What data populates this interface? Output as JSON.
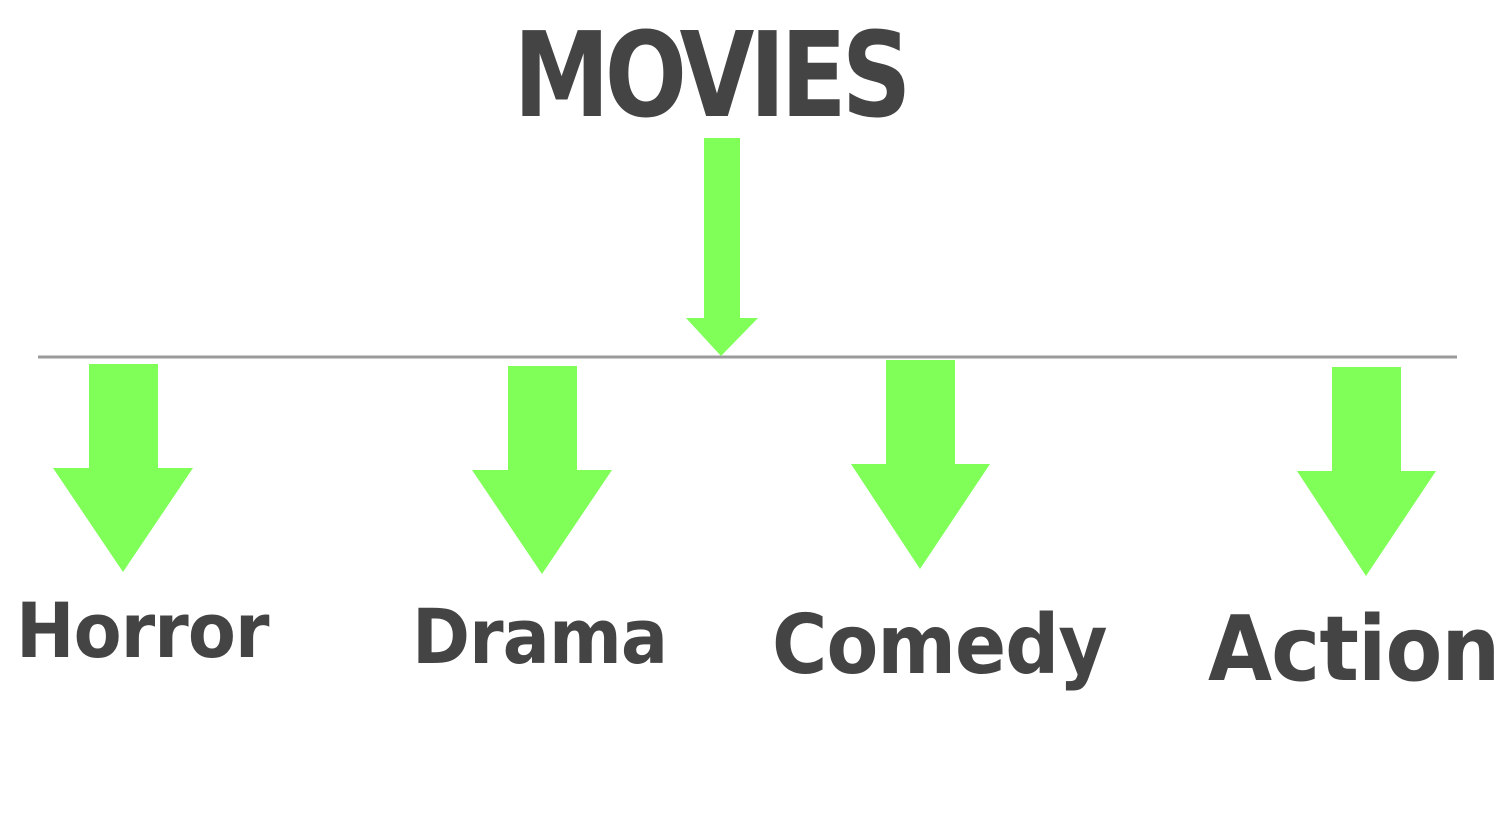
{
  "diagram": {
    "title": "MOVIES",
    "categories": [
      {
        "id": "horror",
        "label": "Horror"
      },
      {
        "id": "drama",
        "label": "Drama"
      },
      {
        "id": "comedy",
        "label": "Comedy"
      },
      {
        "id": "action",
        "label": "Action"
      }
    ],
    "colors": {
      "arrow": "#80ff59",
      "text": "#444444",
      "connector_line": "#9a9a9a",
      "background": "#ffffff"
    }
  }
}
